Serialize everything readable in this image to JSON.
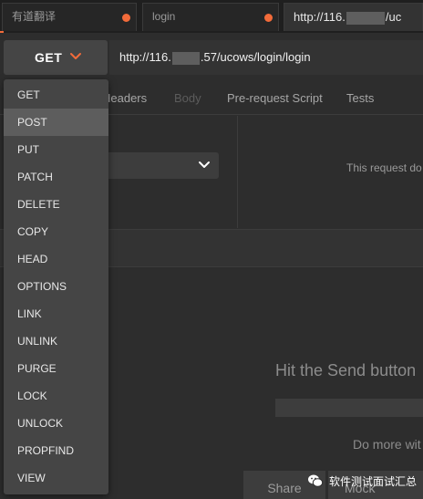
{
  "tabs": [
    {
      "label": "有道翻译",
      "active": false,
      "dirty": true
    },
    {
      "label": "login",
      "active": false,
      "dirty": true
    },
    {
      "label_prefix": "http://116.",
      "label_suffix": "/uc",
      "active": true
    }
  ],
  "request": {
    "method": "GET",
    "url_prefix": "http://116.",
    "url_suffix": ".57/ucows/login/login"
  },
  "subtabs": [
    "Headers",
    "Body",
    "Pre-request Script",
    "Tests"
  ],
  "method_menu": {
    "items": [
      "GET",
      "POST",
      "PUT",
      "PATCH",
      "DELETE",
      "COPY",
      "HEAD",
      "OPTIONS",
      "LINK",
      "UNLINK",
      "PURGE",
      "LOCK",
      "UNLOCK",
      "PROPFIND",
      "VIEW"
    ],
    "highlighted": "POST"
  },
  "auth_panel": {
    "info_text": "This request do"
  },
  "response": {
    "hint": "Hit the Send button",
    "more_text": "Do more wit",
    "share_label": "Share",
    "mock_label": "Mock"
  },
  "watermark": {
    "text": "软件测试面试汇总"
  },
  "colors": {
    "accent": "#f26b3a",
    "background": "#2d2d2d",
    "menu": "#454545",
    "menu_highlight": "#5d5d5d"
  },
  "icons": {
    "method_dropdown": "chevron-down-icon",
    "auth_dropdown": "chevron-down-icon",
    "tab_unsaved": "dot-icon",
    "watermark": "wechat-icon"
  }
}
